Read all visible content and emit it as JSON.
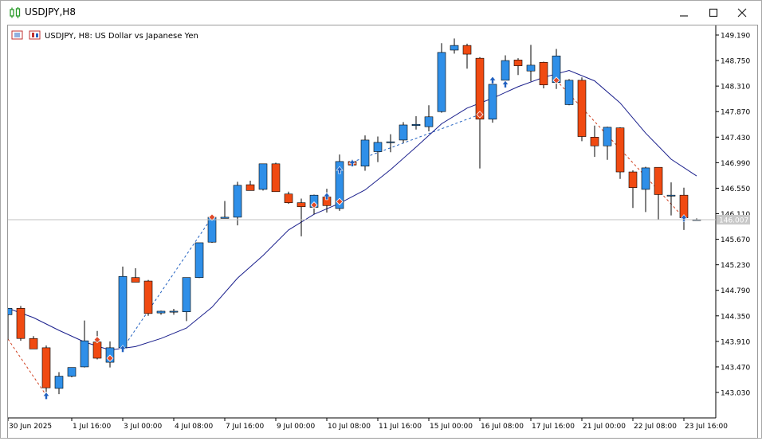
{
  "window": {
    "title": "USDJPY,H8",
    "controls": [
      "minimize",
      "maximize",
      "close"
    ]
  },
  "chart_header": "USDJPY, H8:  US Dollar vs Japanese Yen",
  "price_label": "146.007",
  "colors": {
    "bull": "#2f8fe8",
    "bear": "#f04a12",
    "ma": "#1a1f8c",
    "grid": "#cfcfcf",
    "price_line": "#c0c0c0"
  },
  "chart_data": {
    "type": "candlestick",
    "symbol": "USDJPY",
    "timeframe": "H8",
    "ylim": [
      142.66,
      149.43
    ],
    "y_ticks": [
      "149.190",
      "148.750",
      "148.310",
      "147.870",
      "147.430",
      "146.990",
      "146.550",
      "146.110",
      "145.670",
      "145.230",
      "144.790",
      "144.350",
      "143.910",
      "143.470",
      "143.030"
    ],
    "x_labels": [
      {
        "i": 0,
        "text": "30 Jun 2025"
      },
      {
        "i": 5,
        "text": "1 Jul 16:00"
      },
      {
        "i": 9,
        "text": "3 Jul 00:00"
      },
      {
        "i": 13,
        "text": "4 Jul 08:00"
      },
      {
        "i": 17,
        "text": "7 Jul 16:00"
      },
      {
        "i": 21,
        "text": "9 Jul 00:00"
      },
      {
        "i": 25,
        "text": "10 Jul 08:00"
      },
      {
        "i": 29,
        "text": "11 Jul 16:00"
      },
      {
        "i": 33,
        "text": "15 Jul 00:00"
      },
      {
        "i": 37,
        "text": "16 Jul 08:00"
      },
      {
        "i": 41,
        "text": "17 Jul 16:00"
      },
      {
        "i": 45,
        "text": "21 Jul 00:00"
      },
      {
        "i": 49,
        "text": "22 Jul 08:00"
      },
      {
        "i": 53,
        "text": "23 Jul 16:00"
      }
    ],
    "candles": [
      {
        "o": 144.37,
        "h": 144.47,
        "l": 143.94,
        "c": 144.48
      },
      {
        "o": 144.48,
        "h": 144.52,
        "l": 143.92,
        "c": 143.96
      },
      {
        "o": 143.96,
        "h": 144.0,
        "l": 143.78,
        "c": 143.78
      },
      {
        "o": 143.8,
        "h": 143.84,
        "l": 142.91,
        "c": 143.11
      },
      {
        "o": 143.1,
        "h": 143.38,
        "l": 143.0,
        "c": 143.31
      },
      {
        "o": 143.31,
        "h": 143.46,
        "l": 143.29,
        "c": 143.46
      },
      {
        "o": 143.47,
        "h": 144.27,
        "l": 143.46,
        "c": 143.92
      },
      {
        "o": 143.9,
        "h": 144.09,
        "l": 143.6,
        "c": 143.62
      },
      {
        "o": 143.55,
        "h": 143.91,
        "l": 143.46,
        "c": 143.8
      },
      {
        "o": 143.8,
        "h": 145.2,
        "l": 143.73,
        "c": 145.03
      },
      {
        "o": 145.01,
        "h": 145.17,
        "l": 144.94,
        "c": 144.93
      },
      {
        "o": 144.95,
        "h": 144.97,
        "l": 144.35,
        "c": 144.39
      },
      {
        "o": 144.4,
        "h": 144.44,
        "l": 144.37,
        "c": 144.43
      },
      {
        "o": 144.43,
        "h": 144.47,
        "l": 144.37,
        "c": 144.43
      },
      {
        "o": 144.42,
        "h": 145.01,
        "l": 144.26,
        "c": 145.01
      },
      {
        "o": 145.01,
        "h": 145.61,
        "l": 145.0,
        "c": 145.61
      },
      {
        "o": 145.62,
        "h": 146.05,
        "l": 145.61,
        "c": 146.05
      },
      {
        "o": 146.03,
        "h": 146.33,
        "l": 146.03,
        "c": 146.05
      },
      {
        "o": 146.05,
        "h": 146.66,
        "l": 145.91,
        "c": 146.6
      },
      {
        "o": 146.61,
        "h": 146.68,
        "l": 146.51,
        "c": 146.51
      },
      {
        "o": 146.53,
        "h": 146.97,
        "l": 146.51,
        "c": 146.97
      },
      {
        "o": 146.97,
        "h": 146.99,
        "l": 146.49,
        "c": 146.49
      },
      {
        "o": 146.45,
        "h": 146.49,
        "l": 146.28,
        "c": 146.3
      },
      {
        "o": 146.3,
        "h": 146.37,
        "l": 145.72,
        "c": 146.23
      },
      {
        "o": 146.22,
        "h": 146.44,
        "l": 146.1,
        "c": 146.43
      },
      {
        "o": 146.4,
        "h": 146.54,
        "l": 146.13,
        "c": 146.25
      },
      {
        "o": 146.2,
        "h": 147.13,
        "l": 146.16,
        "c": 147.01
      },
      {
        "o": 147.01,
        "h": 147.05,
        "l": 146.94,
        "c": 146.95
      },
      {
        "o": 146.93,
        "h": 147.46,
        "l": 146.85,
        "c": 147.38
      },
      {
        "o": 147.18,
        "h": 147.44,
        "l": 147.0,
        "c": 147.34
      },
      {
        "o": 147.35,
        "h": 147.48,
        "l": 147.17,
        "c": 147.35
      },
      {
        "o": 147.38,
        "h": 147.69,
        "l": 147.33,
        "c": 147.64
      },
      {
        "o": 147.63,
        "h": 147.79,
        "l": 147.56,
        "c": 147.65
      },
      {
        "o": 147.61,
        "h": 147.98,
        "l": 147.53,
        "c": 147.78
      },
      {
        "o": 147.87,
        "h": 149.05,
        "l": 147.85,
        "c": 148.89
      },
      {
        "o": 148.93,
        "h": 149.13,
        "l": 148.87,
        "c": 149.01
      },
      {
        "o": 149.01,
        "h": 149.04,
        "l": 148.61,
        "c": 148.86
      },
      {
        "o": 148.79,
        "h": 148.81,
        "l": 146.89,
        "c": 147.74
      },
      {
        "o": 147.74,
        "h": 148.3,
        "l": 147.68,
        "c": 148.34
      },
      {
        "o": 148.41,
        "h": 148.84,
        "l": 148.31,
        "c": 148.75
      },
      {
        "o": 148.76,
        "h": 148.79,
        "l": 148.5,
        "c": 148.66
      },
      {
        "o": 148.57,
        "h": 149.02,
        "l": 148.39,
        "c": 148.67
      },
      {
        "o": 148.72,
        "h": 148.73,
        "l": 148.27,
        "c": 148.33
      },
      {
        "o": 148.37,
        "h": 148.95,
        "l": 148.26,
        "c": 148.83
      },
      {
        "o": 147.99,
        "h": 148.43,
        "l": 147.98,
        "c": 148.41
      },
      {
        "o": 148.41,
        "h": 148.46,
        "l": 147.36,
        "c": 147.44
      },
      {
        "o": 147.43,
        "h": 147.63,
        "l": 147.09,
        "c": 147.28
      },
      {
        "o": 147.28,
        "h": 147.61,
        "l": 147.04,
        "c": 147.6
      },
      {
        "o": 147.59,
        "h": 147.6,
        "l": 146.71,
        "c": 146.83
      },
      {
        "o": 146.83,
        "h": 146.86,
        "l": 146.21,
        "c": 146.56
      },
      {
        "o": 146.53,
        "h": 146.92,
        "l": 146.14,
        "c": 146.9
      },
      {
        "o": 146.91,
        "h": 146.91,
        "l": 146.01,
        "c": 146.44
      },
      {
        "o": 146.43,
        "h": 146.65,
        "l": 146.08,
        "c": 146.43
      },
      {
        "o": 146.43,
        "h": 146.56,
        "l": 145.83,
        "c": 146.04
      },
      {
        "o": 146.01,
        "h": 146.03,
        "l": 146.0,
        "c": 146.01
      }
    ],
    "moving_average": [
      {
        "i": 0,
        "v": 144.48
      },
      {
        "i": 2,
        "v": 144.32
      },
      {
        "i": 4,
        "v": 144.1
      },
      {
        "i": 6,
        "v": 143.9
      },
      {
        "i": 8,
        "v": 143.76
      },
      {
        "i": 10,
        "v": 143.82
      },
      {
        "i": 12,
        "v": 143.96
      },
      {
        "i": 14,
        "v": 144.14
      },
      {
        "i": 16,
        "v": 144.5
      },
      {
        "i": 18,
        "v": 145.0
      },
      {
        "i": 20,
        "v": 145.39
      },
      {
        "i": 22,
        "v": 145.83
      },
      {
        "i": 24,
        "v": 146.1
      },
      {
        "i": 26,
        "v": 146.29
      },
      {
        "i": 28,
        "v": 146.52
      },
      {
        "i": 30,
        "v": 146.87
      },
      {
        "i": 32,
        "v": 147.26
      },
      {
        "i": 34,
        "v": 147.66
      },
      {
        "i": 36,
        "v": 147.93
      },
      {
        "i": 38,
        "v": 148.1
      },
      {
        "i": 40,
        "v": 148.3
      },
      {
        "i": 42,
        "v": 148.46
      },
      {
        "i": 44,
        "v": 148.58
      },
      {
        "i": 46,
        "v": 148.4
      },
      {
        "i": 48,
        "v": 148.02
      },
      {
        "i": 50,
        "v": 147.5
      },
      {
        "i": 52,
        "v": 147.05
      },
      {
        "i": 54,
        "v": 146.76
      }
    ],
    "signal_markers": [
      {
        "i": 3,
        "p": 142.98,
        "dir": "up"
      },
      {
        "i": 7,
        "p": 143.94,
        "dir": "down"
      },
      {
        "i": 8,
        "p": 143.62,
        "dir": "down"
      },
      {
        "i": 9,
        "p": 143.79,
        "dir": "up"
      },
      {
        "i": 16,
        "p": 146.05,
        "dir": "down"
      },
      {
        "i": 24,
        "p": 146.26,
        "dir": "down"
      },
      {
        "i": 25,
        "p": 146.42,
        "dir": "up"
      },
      {
        "i": 26,
        "p": 146.32,
        "dir": "down"
      },
      {
        "i": 26,
        "p": 146.87,
        "dir": "up"
      },
      {
        "i": 27,
        "p": 146.99,
        "dir": "up"
      },
      {
        "i": 37,
        "p": 147.82,
        "dir": "down"
      },
      {
        "i": 38,
        "p": 148.42,
        "dir": "up"
      },
      {
        "i": 39,
        "p": 148.35,
        "dir": "up"
      },
      {
        "i": 43,
        "p": 148.41,
        "dir": "down"
      },
      {
        "i": 53,
        "p": 146.04,
        "dir": "up"
      }
    ]
  }
}
